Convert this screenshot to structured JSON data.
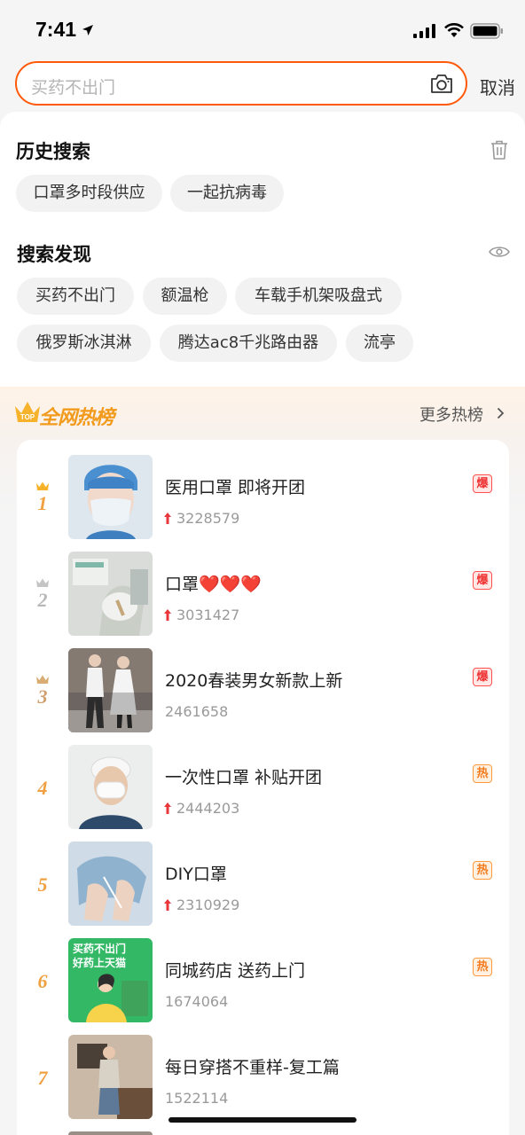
{
  "status": {
    "time": "7:41"
  },
  "search": {
    "placeholder": "买药不出门",
    "cancel": "取消"
  },
  "history": {
    "title": "历史搜索",
    "chips": [
      "口罩多时段供应",
      "一起抗病毒"
    ]
  },
  "discover": {
    "title": "搜索发现",
    "chips": [
      "买药不出门",
      "额温枪",
      "车载手机架吸盘式",
      "俄罗斯冰淇淋",
      "腾达ac8千兆路由器",
      "流亭"
    ]
  },
  "hot": {
    "title": "全网热榜",
    "logo_text": "TOP",
    "more": "更多热榜",
    "items": [
      {
        "rank": "1",
        "title": "医用口罩 即将开团",
        "count": "3228579",
        "rising": true,
        "badge": "爆"
      },
      {
        "rank": "2",
        "title": "口罩❤️❤️❤️",
        "count": "3031427",
        "rising": true,
        "badge": "爆"
      },
      {
        "rank": "3",
        "title": "2020春装男女新款上新",
        "count": "2461658",
        "rising": false,
        "badge": "爆"
      },
      {
        "rank": "4",
        "title": "一次性口罩 补贴开团",
        "count": "2444203",
        "rising": true,
        "badge": "热"
      },
      {
        "rank": "5",
        "title": "DIY口罩",
        "count": "2310929",
        "rising": true,
        "badge": "热"
      },
      {
        "rank": "6",
        "title": "同城药店 送药上门",
        "count": "1674064",
        "rising": false,
        "badge": "热"
      },
      {
        "rank": "7",
        "title": "每日穿搭不重样-复工篇",
        "count": "1522114",
        "rising": false,
        "badge": ""
      }
    ],
    "thumb6_text": [
      "买药不出门",
      "好药上天猫"
    ]
  },
  "colors": {
    "accent": "#ff5a0a",
    "gold": "#f29a1c",
    "rank_orange": "#f0a040",
    "rank_silver": "#b8b8b8",
    "rank_bronze": "#d0a070"
  }
}
